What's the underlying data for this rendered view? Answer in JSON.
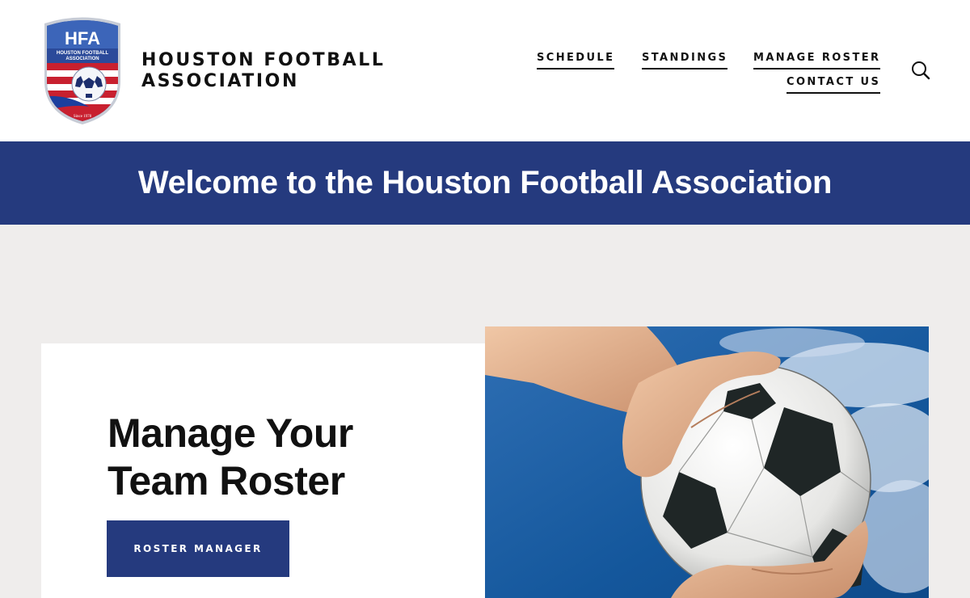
{
  "header": {
    "logo": {
      "initials": "HFA",
      "ribbon_line1": "HOUSTON FOOTBALL",
      "ribbon_line2": "ASSOCIATION",
      "since": "Since 1978"
    },
    "site_title_line1": "HOUSTON FOOTBALL",
    "site_title_line2": "ASSOCIATION",
    "nav": [
      {
        "label": "SCHEDULE"
      },
      {
        "label": "STANDINGS"
      },
      {
        "label": "MANAGE ROSTER"
      },
      {
        "label": "CONTACT US"
      }
    ],
    "search_icon": "search-icon"
  },
  "banner": {
    "title": "Welcome to the Houston Football Association"
  },
  "hero": {
    "heading": "Manage Your Team Roster",
    "button_label": "ROSTER MANAGER",
    "image_alt": "Hands holding a soccer ball against a blue sky"
  },
  "colors": {
    "brand_navy": "#253a7e",
    "page_bg": "#efedec",
    "text": "#111111"
  }
}
